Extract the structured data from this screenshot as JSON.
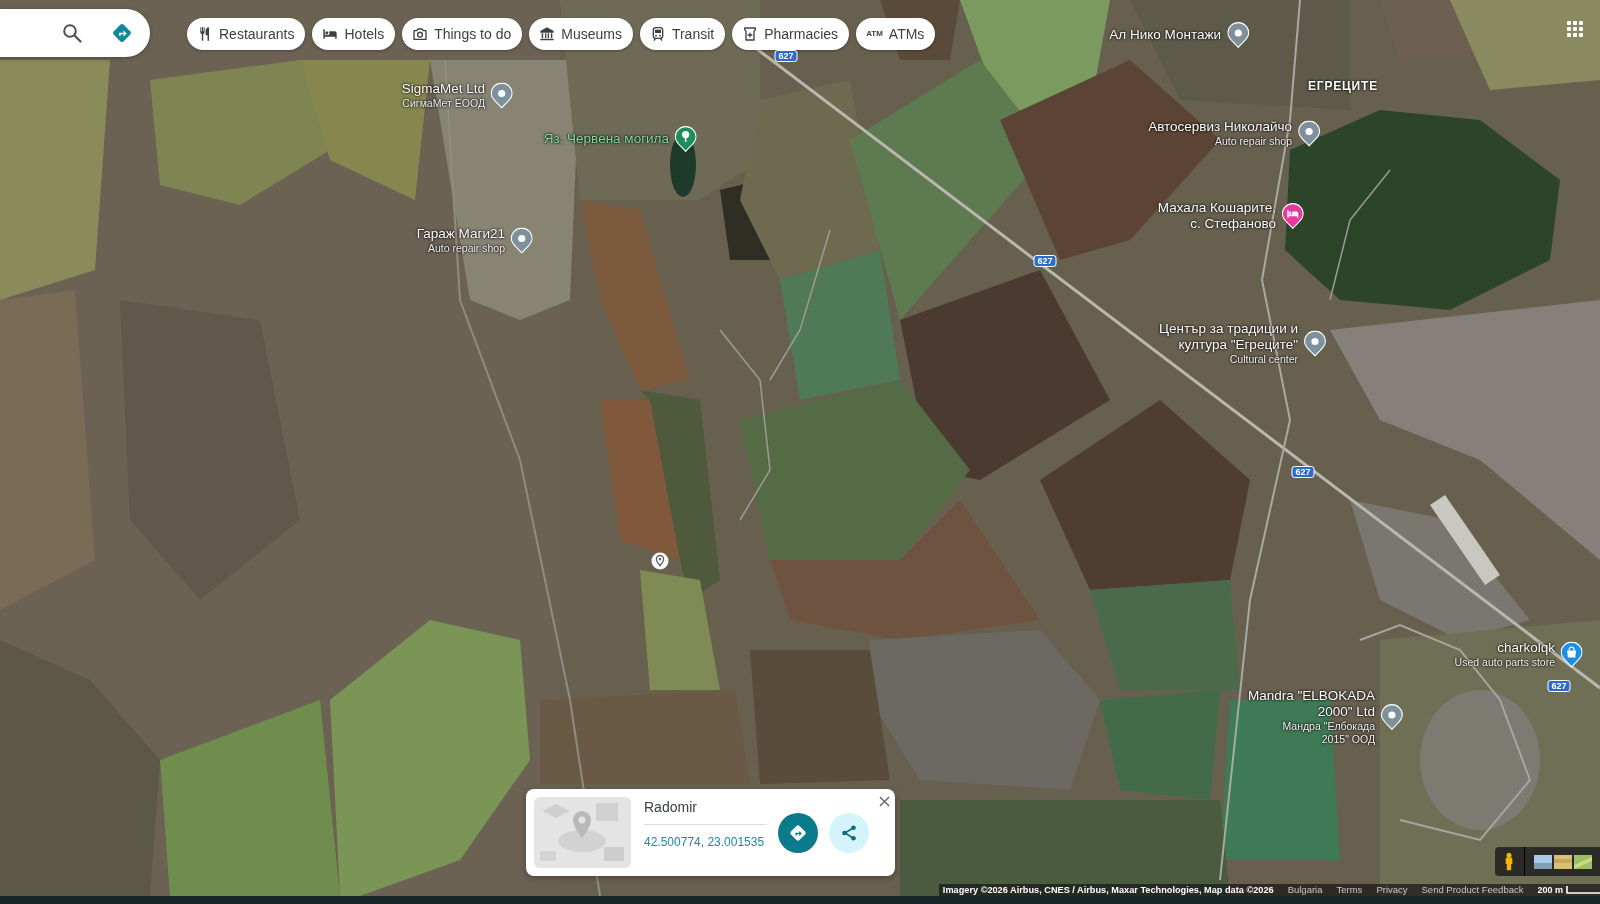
{
  "category_chips": [
    {
      "label": "Restaurants",
      "selected": false
    },
    {
      "label": "Hotels",
      "selected": false
    },
    {
      "label": "Things to do",
      "selected": false
    },
    {
      "label": "Museums",
      "selected": false
    },
    {
      "label": "Transit",
      "selected": false
    },
    {
      "label": "Pharmacies",
      "selected": false
    },
    {
      "label": "ATMs",
      "selected": false,
      "icon_text": "ATM"
    }
  ],
  "road_shields": [
    "627",
    "627",
    "627",
    "627"
  ],
  "places": [
    {
      "kind": "poi",
      "name": "Ал Нико Монтажи",
      "color": "#7d909b"
    },
    {
      "kind": "poi",
      "name": "SigmaMet Ltd",
      "subtitle": "СигмаМет ЕООД",
      "color": "#7d909b"
    },
    {
      "kind": "town",
      "name": "ЕГРЕЦИТЕ"
    },
    {
      "kind": "park",
      "name": "Яз. Червена могила",
      "color": "#1e8e5c"
    },
    {
      "kind": "poi",
      "name": "Автосервиз Николайчо",
      "subtitle": "Auto repair shop",
      "color": "#7d909b"
    },
    {
      "kind": "lodging",
      "name": "Махала Кошарите,\nс. Стефаново",
      "color": "#e5399e"
    },
    {
      "kind": "poi",
      "name": "Гараж Маги21",
      "subtitle": "Auto repair shop",
      "color": "#7d909b"
    },
    {
      "kind": "poi",
      "name": "Център за традиции и\nкултура \"Егреците\"",
      "subtitle": "Cultural center",
      "color": "#7d909b"
    },
    {
      "kind": "dropped_pin"
    },
    {
      "kind": "shopping",
      "name": "charkolqk",
      "subtitle": "Used auto parts store",
      "color": "#1a8fe6"
    },
    {
      "kind": "poi",
      "name": "Mandra \"ELBOKADA\n2000\" Ltd",
      "subtitle": "Мандра \"Елбокада\n2015\" ООД",
      "color": "#7d909b"
    }
  ],
  "place_card": {
    "title": "Radomir",
    "coordinates": "42.500774, 23.001535"
  },
  "attribution": {
    "imagery": "Imagery ©2026 Airbus, CNES / Airbus, Maxar Technologies, Map data ©2026",
    "links": [
      "Bulgaria",
      "Terms",
      "Privacy",
      "Send Product Feedback"
    ],
    "scale": "200 m"
  }
}
